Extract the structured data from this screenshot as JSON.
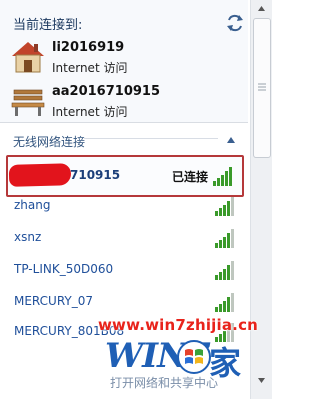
{
  "current_section": {
    "title": "当前连接到:",
    "connections": [
      {
        "name": "li2016919",
        "status": "Internet 访问",
        "icon": "house-icon"
      },
      {
        "name": "aa2016710915",
        "status": "Internet 访问",
        "icon": "park-bench-icon"
      }
    ]
  },
  "wireless_section": {
    "header": "无线网络连接",
    "networks": [
      {
        "ssid": "aa2016710915",
        "visible_ssid": "710915",
        "status": "已连接",
        "selected": true,
        "signal": 5
      },
      {
        "ssid": "zhang",
        "signal": 4
      },
      {
        "ssid": "xsnz",
        "signal": 4
      },
      {
        "ssid": "TP-LINK_50D060",
        "signal": 4
      },
      {
        "ssid": "MERCURY_07",
        "signal": 4
      },
      {
        "ssid": "MERCURY_801B08",
        "signal": 3
      }
    ]
  },
  "footer": {
    "link": "打开网络和共享中心"
  },
  "watermark": {
    "url": "www.win7zhijia.cn",
    "logo_text": "WIN7",
    "logo_char": "家"
  },
  "colors": {
    "link": "#1f4f9a",
    "selection_border": "#b5383a",
    "signal_green": "#3a9a2a",
    "watermark_red": "#e8231b",
    "watermark_blue": "#1f5fb5"
  }
}
